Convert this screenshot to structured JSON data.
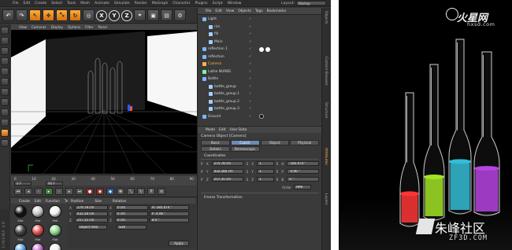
{
  "menu": [
    "File",
    "Edit",
    "Create",
    "Select",
    "Tools",
    "Mesh",
    "Animate",
    "Simulate",
    "Render",
    "MoGraph",
    "Character",
    "Plugins",
    "Script",
    "Window"
  ],
  "layout": {
    "label": "Layout:",
    "value": "Startup"
  },
  "toolbar": {
    "axis_buttons": [
      "X",
      "Y",
      "Z"
    ]
  },
  "viewport": {
    "menu": [
      "View",
      "Cameras",
      "Display",
      "Options",
      "Filter",
      "Panel"
    ]
  },
  "timeline": {
    "ticks": [
      "0",
      "10",
      "20",
      "30",
      "40",
      "50",
      "60",
      "70",
      "80",
      "90"
    ],
    "start_field": "0 F",
    "end_field": "90 F"
  },
  "materials": {
    "menu": [
      "Create",
      "Edit",
      "Function",
      "Texture"
    ],
    "items": [
      {
        "name": "Mat",
        "color": "#111"
      },
      {
        "name": "Mat",
        "color": "#c9c9c9"
      },
      {
        "name": "Mat",
        "color": "#f2f2f2"
      },
      {
        "name": "Mat",
        "color": "#444"
      },
      {
        "name": "Mat",
        "color": "#e05050"
      },
      {
        "name": "Mat",
        "color": "#8fd68f"
      },
      {
        "name": "Mat",
        "color": "#5ea2e0"
      },
      {
        "name": "Mat",
        "color": "#c070d0"
      },
      {
        "name": "Mat",
        "color": "#f0f0f0"
      }
    ]
  },
  "coord_small": {
    "headers": [
      "Position",
      "Size",
      "Rotation"
    ],
    "rows": [
      {
        "axis": "X",
        "pos": "279.78 cm",
        "size": "0 cm",
        "rot": "H  -185.074 °"
      },
      {
        "axis": "Y",
        "pos": "432.28 cm",
        "size": "0 cm",
        "rot": "P  -4.96 °"
      },
      {
        "axis": "Z",
        "pos": "257.35 cm",
        "size": "0 cm",
        "rot": "B  0 °"
      }
    ],
    "mode": "Object (Rel)",
    "size_mode": "Size",
    "apply": "Apply"
  },
  "cinema_label": "CINEMA 4D",
  "objects": {
    "menu": [
      "File",
      "Edit",
      "View",
      "Objects",
      "Tags",
      "Bookmarks"
    ],
    "rows": [
      {
        "name": "Light",
        "indent": 0,
        "color": "#7bb7ff"
      },
      {
        "name": "rim",
        "indent": 1,
        "color": "#9fd0ff"
      },
      {
        "name": "fill",
        "indent": 1,
        "color": "#9fd0ff"
      },
      {
        "name": "Main",
        "indent": 1,
        "color": "#9fd0ff"
      },
      {
        "name": "reflection 1",
        "indent": 0,
        "color": "#7bb7ff"
      },
      {
        "name": "reflection",
        "indent": 0,
        "color": "#7bb7ff"
      },
      {
        "name": "Camera",
        "indent": 0,
        "color": "#ffb347",
        "selected": true
      },
      {
        "name": "Lathe NURBS",
        "indent": 0,
        "color": "#7bff9c"
      },
      {
        "name": "Bottle",
        "indent": 0,
        "color": "#7bb7ff"
      },
      {
        "name": "bottle_group",
        "indent": 1,
        "color": "#9fd0ff"
      },
      {
        "name": "bottle_group.1",
        "indent": 1,
        "color": "#9fd0ff"
      },
      {
        "name": "bottle_group.2",
        "indent": 1,
        "color": "#9fd0ff"
      },
      {
        "name": "bottle_group.3",
        "indent": 1,
        "color": "#9fd0ff"
      },
      {
        "name": "Ground",
        "indent": 0,
        "color": "#7bb7ff"
      }
    ]
  },
  "attributes": {
    "menu": [
      "Mode",
      "Edit",
      "User Data"
    ],
    "title": "Camera Object [Camera]",
    "tabs": [
      "Basic",
      "Coord.",
      "Object",
      "Physical",
      "Details",
      "Stereoscopic"
    ],
    "active_tab": "Coord.",
    "section": "Coordinates",
    "rows": [
      {
        "a": "P",
        "ax": "X",
        "v": "275.78 cm",
        "sa": "S",
        "sx": "X",
        "sv": "1",
        "ra": "R",
        "rx": "H",
        "rv": "-185.074 °"
      },
      {
        "a": "P",
        "ax": "Y",
        "v": "432.280 cm",
        "sa": "S",
        "sx": "Y",
        "sv": "1",
        "ra": "R",
        "rx": "P",
        "rv": "-4.96 °"
      },
      {
        "a": "P",
        "ax": "Z",
        "v": "257.35 cm",
        "sa": "S",
        "sx": "Z",
        "sv": "1",
        "ra": "R",
        "rx": "B",
        "rv": "0 °"
      }
    ],
    "order_label": "Order",
    "order_value": "HPB",
    "freeze": "Freeze Transformation"
  },
  "right_tabs": [
    "Objects",
    "Content Browser",
    "Structure",
    "Attributes",
    "Layers"
  ],
  "watermarks": {
    "top": "火星网",
    "top_sub": "hxsd.com",
    "bottom": "朱峰社区",
    "bottom_sub": "ZF3D.COM"
  },
  "photo": {
    "bottles": [
      {
        "liquid": "#ff2a2a"
      },
      {
        "liquid": "#9ee21a"
      },
      {
        "liquid": "#29b9d4"
      },
      {
        "liquid": "#b13adf"
      }
    ]
  }
}
